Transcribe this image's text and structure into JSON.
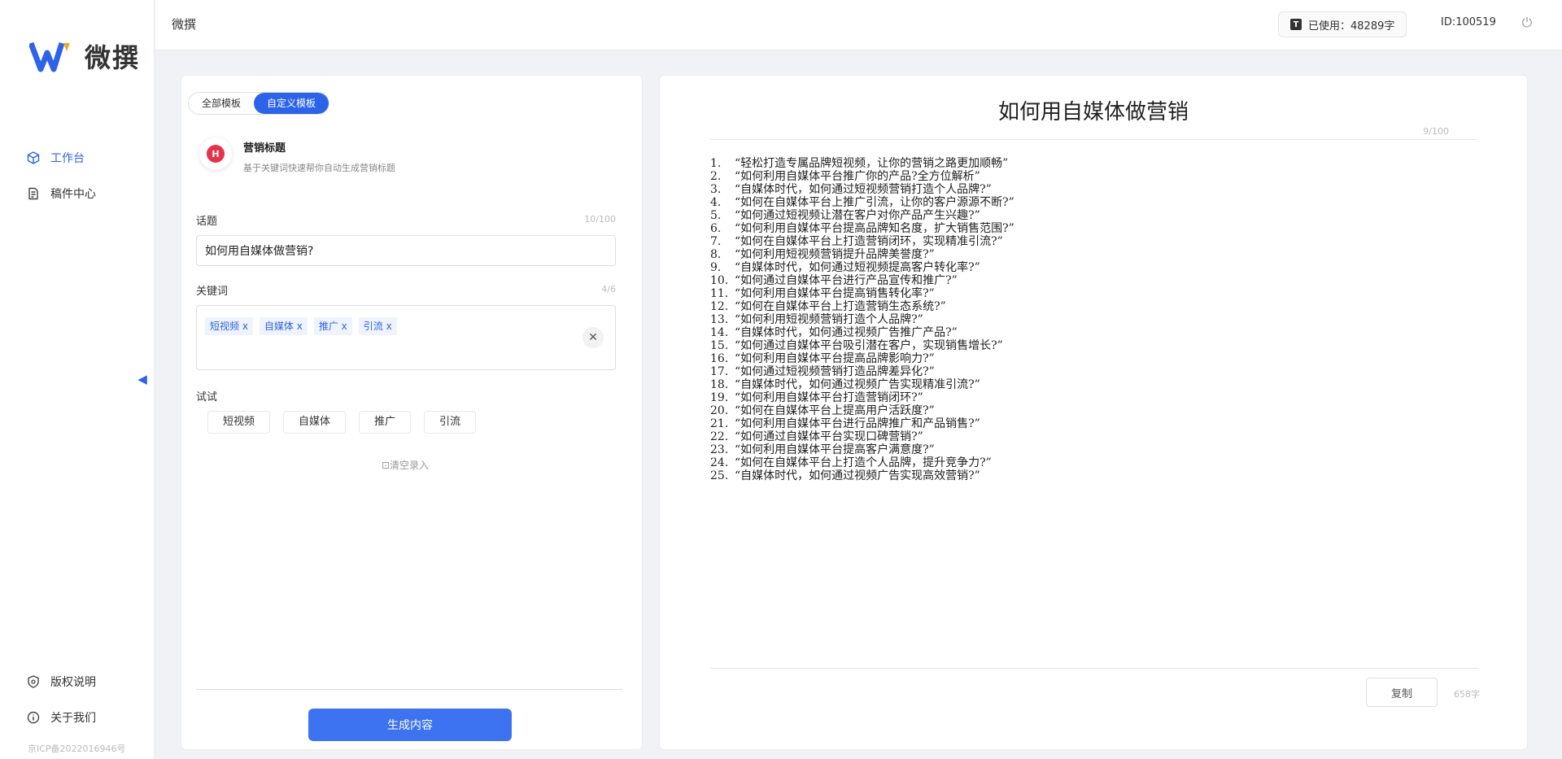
{
  "brand": {
    "name": "微撰"
  },
  "sidebar": {
    "items": [
      {
        "label": "工作台",
        "icon": "cube-icon",
        "active": true
      },
      {
        "label": "稿件中心",
        "icon": "document-icon",
        "active": false
      }
    ],
    "bottom_items": [
      {
        "label": "版权说明",
        "icon": "shield-icon"
      },
      {
        "label": "关于我们",
        "icon": "info-icon"
      }
    ],
    "icp": "京ICP备2022016946号"
  },
  "topbar": {
    "title": "微撰",
    "usage_label": "已使用：48289字",
    "user_id": "ID:100519"
  },
  "left": {
    "tabs": [
      {
        "label": "全部模板",
        "active": false
      },
      {
        "label": "自定义模板",
        "active": true
      }
    ],
    "template": {
      "icon_text": "H",
      "name": "营销标题",
      "desc": "基于关键词快速帮你自动生成营销标题"
    },
    "topic": {
      "label": "话题",
      "count": "10/100",
      "value": "如何用自媒体做营销?"
    },
    "keywords": {
      "label": "关键词",
      "count": "4/6",
      "tags": [
        "短视频 x",
        "自媒体 x",
        "推广 x",
        "引流 x"
      ]
    },
    "try": {
      "label": "试试",
      "chips": [
        "短视频",
        "自媒体",
        "推广",
        "引流"
      ]
    },
    "clear_record": "⊡清空录入",
    "generate_label": "生成内容"
  },
  "right": {
    "title": "如何用自媒体做营销",
    "title_count": "9/100",
    "results": [
      "“轻松打造专属品牌短视频，让你的营销之路更加顺畅”",
      "“如何利用自媒体平台推广你的产品?全方位解析”",
      "“自媒体时代，如何通过短视频营销打造个人品牌?”",
      "“如何在自媒体平台上推广引流，让你的客户源源不断?”",
      "“如何通过短视频让潜在客户对你产品产生兴趣?”",
      "“如何利用自媒体平台提高品牌知名度，扩大销售范围?”",
      "“如何在自媒体平台上打造营销闭环，实现精准引流?”",
      "“如何利用短视频营销提升品牌美誉度?”",
      "“自媒体时代，如何通过短视频提高客户转化率?”",
      "“如何通过自媒体平台进行产品宣传和推广?”",
      "“如何利用自媒体平台提高销售转化率?”",
      "“如何在自媒体平台上打造营销生态系统?”",
      "“如何利用短视频营销打造个人品牌?”",
      "“自媒体时代，如何通过视频广告推广产品?”",
      "“如何通过自媒体平台吸引潜在客户，实现销售增长?”",
      "“如何利用自媒体平台提高品牌影响力?”",
      "“如何通过短视频营销打造品牌差异化?”",
      "“自媒体时代，如何通过视频广告实现精准引流?”",
      "“如何利用自媒体平台打造营销闭环?”",
      "“如何在自媒体平台上提高用户活跃度?”",
      "“如何利用自媒体平台进行品牌推广和产品销售?”",
      "“如何通过自媒体平台实现口碑营销?”",
      "“如何利用自媒体平台提高客户满意度?”",
      "“如何在自媒体平台上打造个人品牌，提升竞争力?”",
      "“自媒体时代，如何通过视频广告实现高效营销?”"
    ],
    "copy_label": "复制",
    "word_count": "658字"
  },
  "colors": {
    "accent": "#2d63e8",
    "brand_red": "#e5334b"
  }
}
